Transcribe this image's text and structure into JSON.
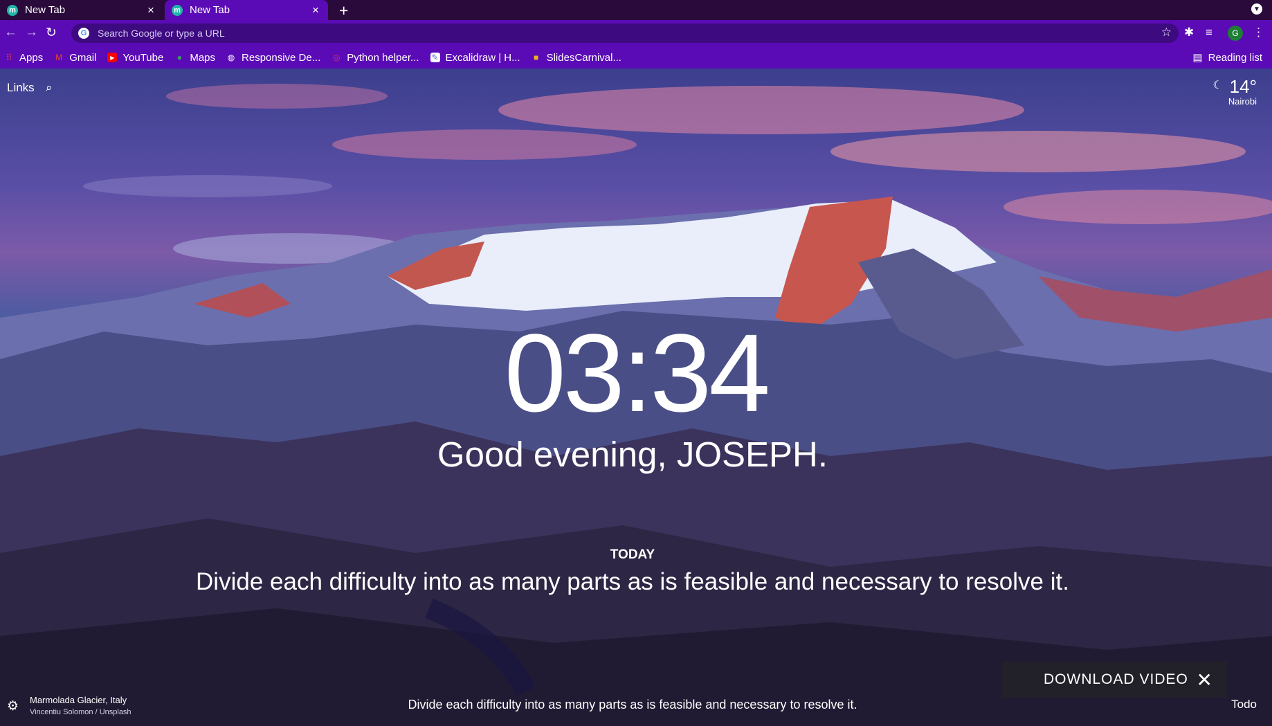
{
  "tabs": [
    {
      "favicon": "m",
      "title": "New Tab",
      "close": "×"
    },
    {
      "favicon": "m",
      "title": "New Tab",
      "close": "×"
    }
  ],
  "new_tab_glyph": "+",
  "toolbar": {
    "back_glyph": "←",
    "forward_glyph": "→",
    "reload_glyph": "↻",
    "google_glyph": "G",
    "address_placeholder": "Search Google or type a URL",
    "star_glyph": "☆",
    "extensions_glyph": "✱",
    "media_glyph": "≡",
    "profile_initial": "G",
    "menu_glyph": "⋮"
  },
  "bookmarks": [
    {
      "label": "Apps",
      "icon": "apps-grid-icon",
      "glyph": "⠿",
      "color": "#ea4335"
    },
    {
      "label": "Gmail",
      "icon": "gmail-icon",
      "glyph": "M",
      "color": "#ea4335"
    },
    {
      "label": "YouTube",
      "icon": "youtube-icon",
      "glyph": "▶",
      "color": "#ff0000"
    },
    {
      "label": "Maps",
      "icon": "maps-icon",
      "glyph": "●",
      "color": "#34a853"
    },
    {
      "label": "Responsive De...",
      "icon": "globe-icon",
      "glyph": "◍",
      "color": "#ffffff"
    },
    {
      "label": "Python helper...",
      "icon": "instagram-icon",
      "glyph": "◎",
      "color": "#e1306c"
    },
    {
      "label": "Excalidraw | H...",
      "icon": "excalidraw-icon",
      "glyph": "✎",
      "color": "#ffffff"
    },
    {
      "label": "SlidesCarnival...",
      "icon": "slidescarnival-icon",
      "glyph": "■",
      "color": "#f6b21b"
    }
  ],
  "reading_list": {
    "label": "Reading list",
    "glyph": "▤"
  },
  "momentum": {
    "links_label": "Links",
    "search_glyph": "⌕",
    "weather_icon": "☾",
    "temperature": "14°",
    "city": "Nairobi",
    "time": "03:34",
    "greeting": "Good evening, JOSEPH.",
    "today_label": "TODAY",
    "focus_text": "Divide each difficulty into as many parts as is feasible and necessary to resolve it.",
    "download_label": "DOWNLOAD VIDEO",
    "download_close": "✕",
    "settings_glyph": "⚙",
    "photo_location": "Marmolada Glacier, Italy",
    "photo_credit": "Vincentiu Solomon / Unsplash",
    "quote": "Divide each difficulty into as many parts as is feasible and necessary to resolve it.",
    "todo_label": "Todo"
  },
  "colors": {
    "tabstrip": "#2a0a3a",
    "toolbar": "#5a0bb6",
    "omnibox": "#3d0a80"
  }
}
